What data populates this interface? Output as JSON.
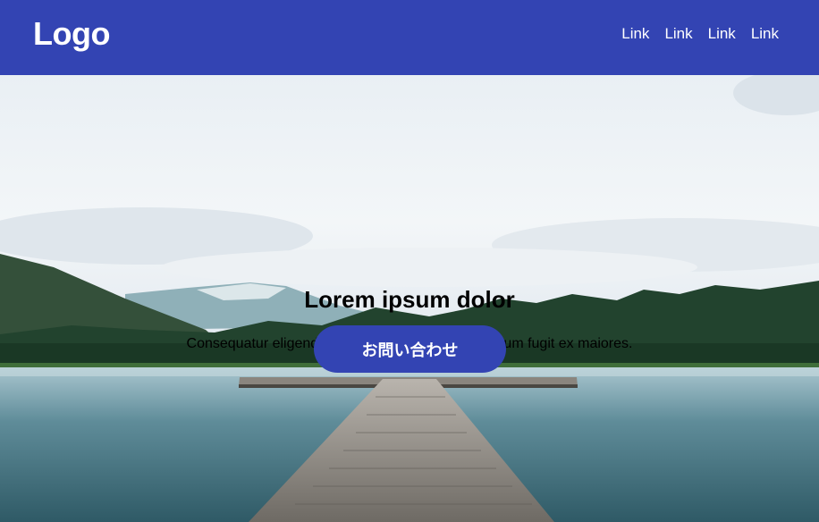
{
  "header": {
    "logo": "Logo",
    "nav": [
      "Link",
      "Link",
      "Link",
      "Link"
    ],
    "background": "#3344b3"
  },
  "hero": {
    "title": "Lorem ipsum dolor",
    "subtitle": "Consequatur eligendi porro illum nesciunt laudantium fugit ex maiores.",
    "cta_label": "お問い合わせ",
    "image": "lake-pier-mountains-forest-photo"
  }
}
